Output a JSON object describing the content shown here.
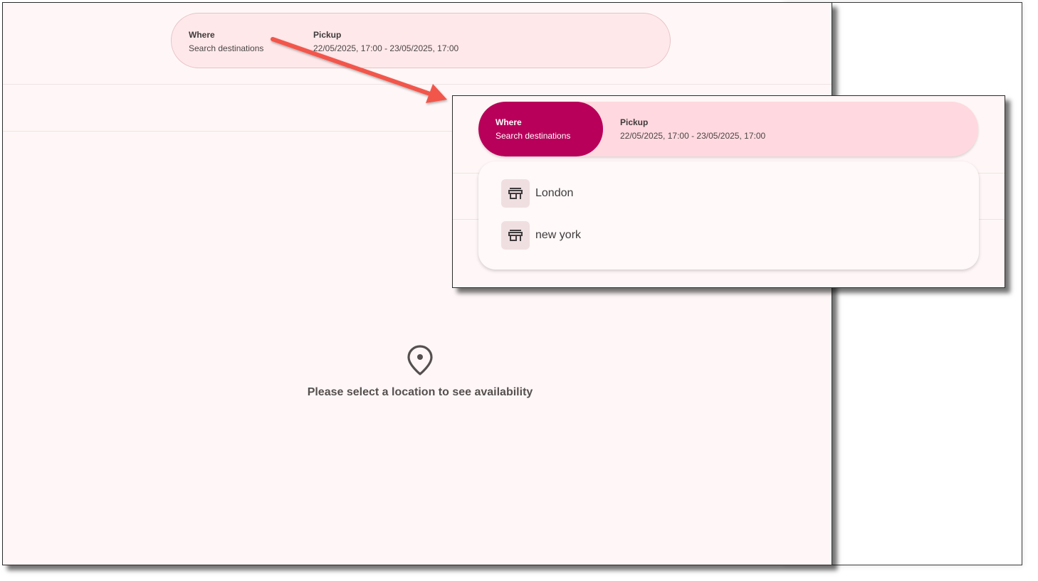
{
  "search": {
    "where_label": "Where",
    "where_value": "Search destinations",
    "pickup_label": "Pickup",
    "pickup_value": "22/05/2025, 17:00 - 23/05/2025, 17:00"
  },
  "empty_state": {
    "message": "Please select a location to see availability",
    "icon": "location-pin-icon"
  },
  "dropdown": {
    "items": [
      {
        "label": "London",
        "icon": "store-icon"
      },
      {
        "label": "new york",
        "icon": "store-icon"
      }
    ]
  },
  "colors": {
    "accent": "#b8005a",
    "arrow": "#f2574b",
    "page_background": "#fff7f7",
    "searchbar_background": "#ffe8ea"
  }
}
